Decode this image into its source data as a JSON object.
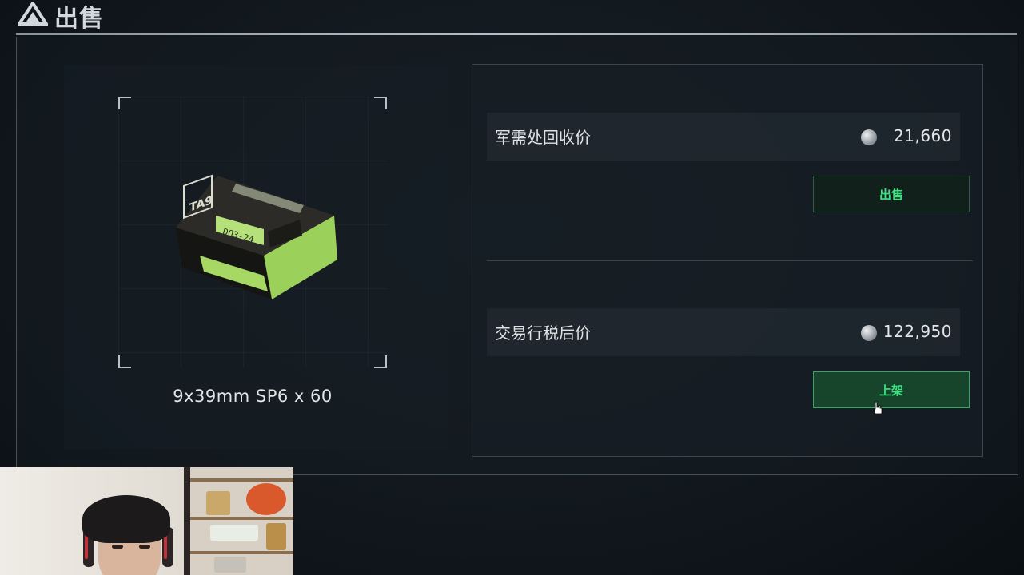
{
  "header": {
    "title": "出售",
    "logo_icon": "triangle-logo-icon"
  },
  "item": {
    "name": "9x39mm SP6 x 60",
    "image_icon": "ammo-box-icon",
    "box_print": {
      "brand": "TA9",
      "code": "DO3-24"
    }
  },
  "prices": {
    "recycle": {
      "label": "军需处回收价",
      "value": "21,660",
      "currency_icon": "coin-icon"
    },
    "sell_button": "出售",
    "trade": {
      "label": "交易行税后价",
      "value": "122,950",
      "currency_icon": "coin-icon"
    },
    "list_button": "上架"
  },
  "colors": {
    "accent_green": "#3fe07f",
    "button_active_bg": "#17452c",
    "panel_border": "#3d454c"
  }
}
